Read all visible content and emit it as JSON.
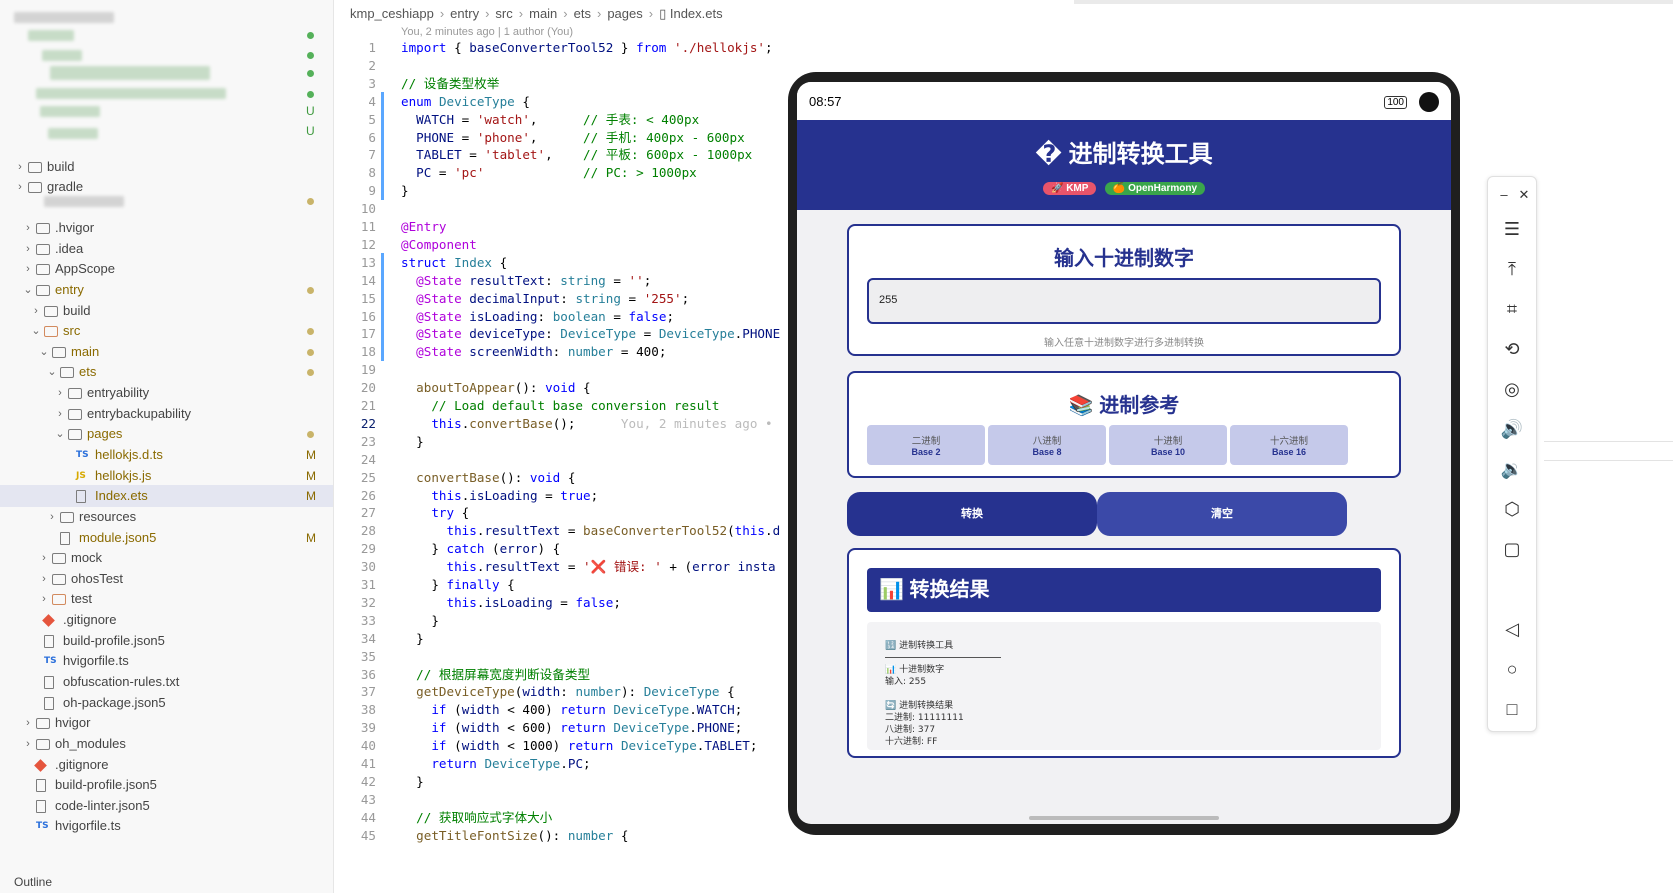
{
  "explorer": {
    "items": [
      {
        "label": "build",
        "kind": "folder-build"
      },
      {
        "label": "gradle",
        "kind": "folder"
      },
      {
        "label": ".hvigor",
        "kind": "folder"
      },
      {
        "label": ".idea",
        "kind": "folder"
      },
      {
        "label": "AppScope",
        "kind": "folder"
      },
      {
        "label": "entry",
        "kind": "folder",
        "color": "mod"
      },
      {
        "label": "build",
        "kind": "folder-build"
      },
      {
        "label": "src",
        "kind": "folder-src",
        "color": "mod"
      },
      {
        "label": "main",
        "kind": "folder",
        "color": "mod"
      },
      {
        "label": "ets",
        "kind": "folder",
        "color": "mod"
      },
      {
        "label": "entryability",
        "kind": "folder"
      },
      {
        "label": "entrybackupability",
        "kind": "folder"
      },
      {
        "label": "pages",
        "kind": "folder",
        "color": "mod"
      },
      {
        "label": "hellokjs.d.ts",
        "kind": "ts",
        "badge": "M",
        "color": "mod"
      },
      {
        "label": "hellokjs.js",
        "kind": "js",
        "badge": "M",
        "color": "mod"
      },
      {
        "label": "Index.ets",
        "kind": "file",
        "badge": "M",
        "color": "mod"
      },
      {
        "label": "resources",
        "kind": "folder-res"
      },
      {
        "label": "module.json5",
        "kind": "file",
        "badge": "M",
        "color": "mod"
      },
      {
        "label": "mock",
        "kind": "folder"
      },
      {
        "label": "ohosTest",
        "kind": "folder"
      },
      {
        "label": "test",
        "kind": "folder-src"
      },
      {
        "label": ".gitignore",
        "kind": "git"
      },
      {
        "label": "build-profile.json5",
        "kind": "file"
      },
      {
        "label": "hvigorfile.ts",
        "kind": "ts"
      },
      {
        "label": "obfuscation-rules.txt",
        "kind": "file"
      },
      {
        "label": "oh-package.json5",
        "kind": "file"
      },
      {
        "label": "hvigor",
        "kind": "folder"
      },
      {
        "label": "oh_modules",
        "kind": "folder"
      },
      {
        "label": ".gitignore",
        "kind": "git"
      },
      {
        "label": "build-profile.json5",
        "kind": "file"
      },
      {
        "label": "code-linter.json5",
        "kind": "file"
      },
      {
        "label": "hvigorfile.ts",
        "kind": "ts"
      }
    ],
    "blurred_badges": [
      "U",
      "U"
    ],
    "outline_label": "Outline"
  },
  "editor": {
    "breadcrumb": [
      "kmp_ceshiapp",
      "entry",
      "src",
      "main",
      "ets",
      "pages",
      "Index.ets"
    ],
    "blame": "You, 2 minutes ago | 1 author (You)",
    "ghost_text": "You, 2 minutes ago •",
    "lines": [
      {
        "n": "1",
        "code": "import { baseConverterTool52 } from './hellokjs';"
      },
      {
        "n": "2",
        "code": ""
      },
      {
        "n": "3",
        "code": "// 设备类型枚举"
      },
      {
        "n": "4",
        "code": "enum DeviceType {"
      },
      {
        "n": "5",
        "code": "  WATCH = 'watch',      // 手表: < 400px"
      },
      {
        "n": "6",
        "code": "  PHONE = 'phone',      // 手机: 400px - 600px"
      },
      {
        "n": "7",
        "code": "  TABLET = 'tablet',    // 平板: 600px - 1000px"
      },
      {
        "n": "8",
        "code": "  PC = 'pc'             // PC: > 1000px"
      },
      {
        "n": "9",
        "code": "}"
      },
      {
        "n": "10",
        "code": ""
      },
      {
        "n": "11",
        "code": "@Entry"
      },
      {
        "n": "12",
        "code": "@Component"
      },
      {
        "n": "13",
        "code": "struct Index {"
      },
      {
        "n": "14",
        "code": "  @State resultText: string = '';"
      },
      {
        "n": "15",
        "code": "  @State decimalInput: string = '255';"
      },
      {
        "n": "16",
        "code": "  @State isLoading: boolean = false;"
      },
      {
        "n": "17",
        "code": "  @State deviceType: DeviceType = DeviceType.PHONE"
      },
      {
        "n": "18",
        "code": "  @State screenWidth: number = 400;"
      },
      {
        "n": "19",
        "code": ""
      },
      {
        "n": "20",
        "code": "  aboutToAppear(): void {"
      },
      {
        "n": "21",
        "code": "    // Load default base conversion result"
      },
      {
        "n": "22",
        "code": "    this.convertBase();"
      },
      {
        "n": "23",
        "code": "  }"
      },
      {
        "n": "24",
        "code": ""
      },
      {
        "n": "25",
        "code": "  convertBase(): void {"
      },
      {
        "n": "26",
        "code": "    this.isLoading = true;"
      },
      {
        "n": "27",
        "code": "    try {"
      },
      {
        "n": "28",
        "code": "      this.resultText = baseConverterTool52(this.d"
      },
      {
        "n": "29",
        "code": "    } catch (error) {"
      },
      {
        "n": "30",
        "code": "      this.resultText = '❌ 错误: ' + (error insta"
      },
      {
        "n": "31",
        "code": "    } finally {"
      },
      {
        "n": "32",
        "code": "      this.isLoading = false;"
      },
      {
        "n": "33",
        "code": "    }"
      },
      {
        "n": "34",
        "code": "  }"
      },
      {
        "n": "35",
        "code": ""
      },
      {
        "n": "36",
        "code": "  // 根据屏幕宽度判断设备类型"
      },
      {
        "n": "37",
        "code": "  getDeviceType(width: number): DeviceType {"
      },
      {
        "n": "38",
        "code": "    if (width < 400) return DeviceType.WATCH;"
      },
      {
        "n": "39",
        "code": "    if (width < 600) return DeviceType.PHONE;"
      },
      {
        "n": "40",
        "code": "    if (width < 1000) return DeviceType.TABLET;"
      },
      {
        "n": "41",
        "code": "    return DeviceType.PC;"
      },
      {
        "n": "42",
        "code": "  }"
      },
      {
        "n": "43",
        "code": ""
      },
      {
        "n": "44",
        "code": "  // 获取响应式字体大小"
      },
      {
        "n": "45",
        "code": "  getTitleFontSize(): number {"
      }
    ]
  },
  "device": {
    "time": "08:57",
    "battery": "100",
    "app": {
      "title": "� 进制转换工具",
      "tag_kmp": "🚀 KMP",
      "tag_oh": "🍊 OpenHarmony",
      "input_card_title": "输入十进制数字",
      "input_value": "255",
      "input_hint": "输入任意十进制数字进行多进制转换",
      "ref_card_title": "📚 进制参考",
      "bases": [
        {
          "name": "二进制",
          "sub": "Base 2"
        },
        {
          "name": "八进制",
          "sub": "Base 8"
        },
        {
          "name": "十进制",
          "sub": "Base 10"
        },
        {
          "name": "十六进制",
          "sub": "Base 16"
        }
      ],
      "convert_button": "转换",
      "clear_button": "清空",
      "result_title": "📊 转换结果",
      "result_lines": [
        "🔢 进制转换工具",
        "📊 十进制数字",
        "输入: 255",
        "🔄 进制转换结果",
        "二进制: 11111111",
        "八进制: 377",
        "十六进制: FF"
      ]
    }
  },
  "toolbar": {
    "icons": [
      "minimize-icon",
      "close-icon",
      "menu-icon",
      "pin-top-icon",
      "crop-icon",
      "rotate-icon",
      "screenshot-icon",
      "volume-up-icon",
      "volume-down-icon",
      "fold-icon",
      "fullscreen-icon",
      "back-icon",
      "home-icon",
      "recents-icon"
    ]
  },
  "colors": {
    "brand": "#26328f",
    "tag_kmp": "#e8546a",
    "tag_oh": "#3aa54b",
    "modified": "#8a6a00",
    "untracked": "#3f9a3f"
  }
}
